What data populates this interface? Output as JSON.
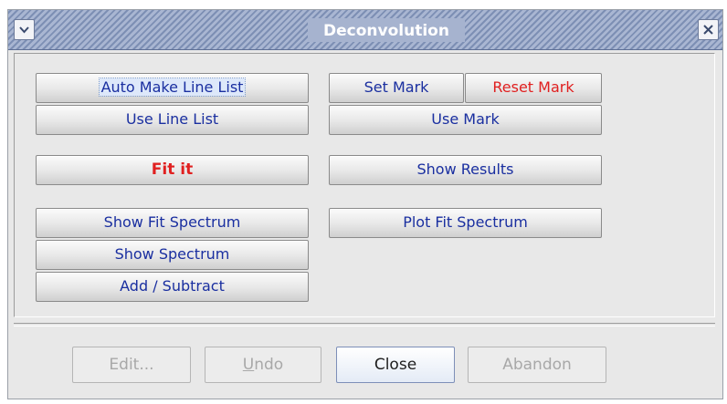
{
  "window": {
    "title": "Deconvolution",
    "menu_icon": "chevron-down-icon",
    "close_icon": "close-icon"
  },
  "buttons": {
    "auto_make_line_list": "Auto Make Line List",
    "use_line_list": "Use Line List",
    "set_mark": "Set Mark",
    "reset_mark": "Reset Mark",
    "use_mark": "Use Mark",
    "fit_it": "Fit it",
    "show_results": "Show Results",
    "show_fit_spectrum": "Show Fit Spectrum",
    "plot_fit_spectrum": "Plot Fit Spectrum",
    "show_spectrum": "Show Spectrum",
    "add_subtract": "Add / Subtract"
  },
  "footer": {
    "edit": "Edit...",
    "undo_mnemonic": "U",
    "undo_rest": "ndo",
    "close": "Close",
    "abandon": "Abandon"
  },
  "colors": {
    "button_text": "#1a2fa0",
    "alert_text": "#e02020",
    "disabled_text": "#a8a8a8"
  }
}
